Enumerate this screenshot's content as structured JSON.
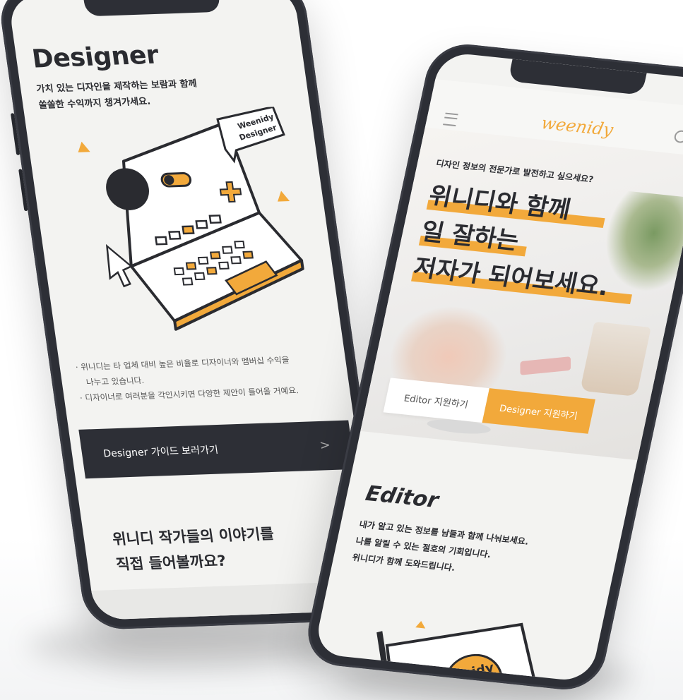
{
  "left_screen": {
    "title": "Designer",
    "subtitle_line1": "가치 있는 디자인을 제작하는 보람과 함께",
    "subtitle_line2": "쏠쏠한 수익까지 챙겨가세요.",
    "illustration_badge_line1": "Weenidy",
    "illustration_badge_line2": "Designer",
    "bullet1_line1": "· 위니디는 타 업체 대비 높은 비율로 디자이너와 멤버십 수익을",
    "bullet1_line2": "나누고 있습니다.",
    "bullet2": "· 디자이너로 여러분을 각인시키면 다양한 제안이 들어올 거예요.",
    "guide_button_label": "Designer 가이드 보러가기",
    "guide_button_chevron": ">",
    "stories_line1": "위니디 작가들의 이야기를",
    "stories_line2": "직접 들어볼까요?"
  },
  "right_screen": {
    "logo_text": "weenidy",
    "menu_icon": "hamburger-icon",
    "search_icon": "search-icon",
    "eyebrow": "디자인 정보의 전문가로 발전하고 싶으세요?",
    "headline_line1": "위니디와 함께",
    "headline_line2": "일 잘하는",
    "headline_line3": "저자가 되어보세요.",
    "cta_editor": "Editor 지원하기",
    "cta_designer": "Designer 지원하기",
    "editor_title": "Editor",
    "editor_body_line1": "내가 알고 있는 정보를 남들과 함께 나눠보세요.",
    "editor_body_line2": "나를 알릴 수 있는 절호의 기회입니다.",
    "editor_body_line3": "위니디가 함께 도와드립니다.",
    "editor_illus_text": "nidy"
  },
  "colors": {
    "accent": "#f2a93b",
    "dark": "#2d2f36",
    "screen_bg": "#f3f3f1"
  }
}
